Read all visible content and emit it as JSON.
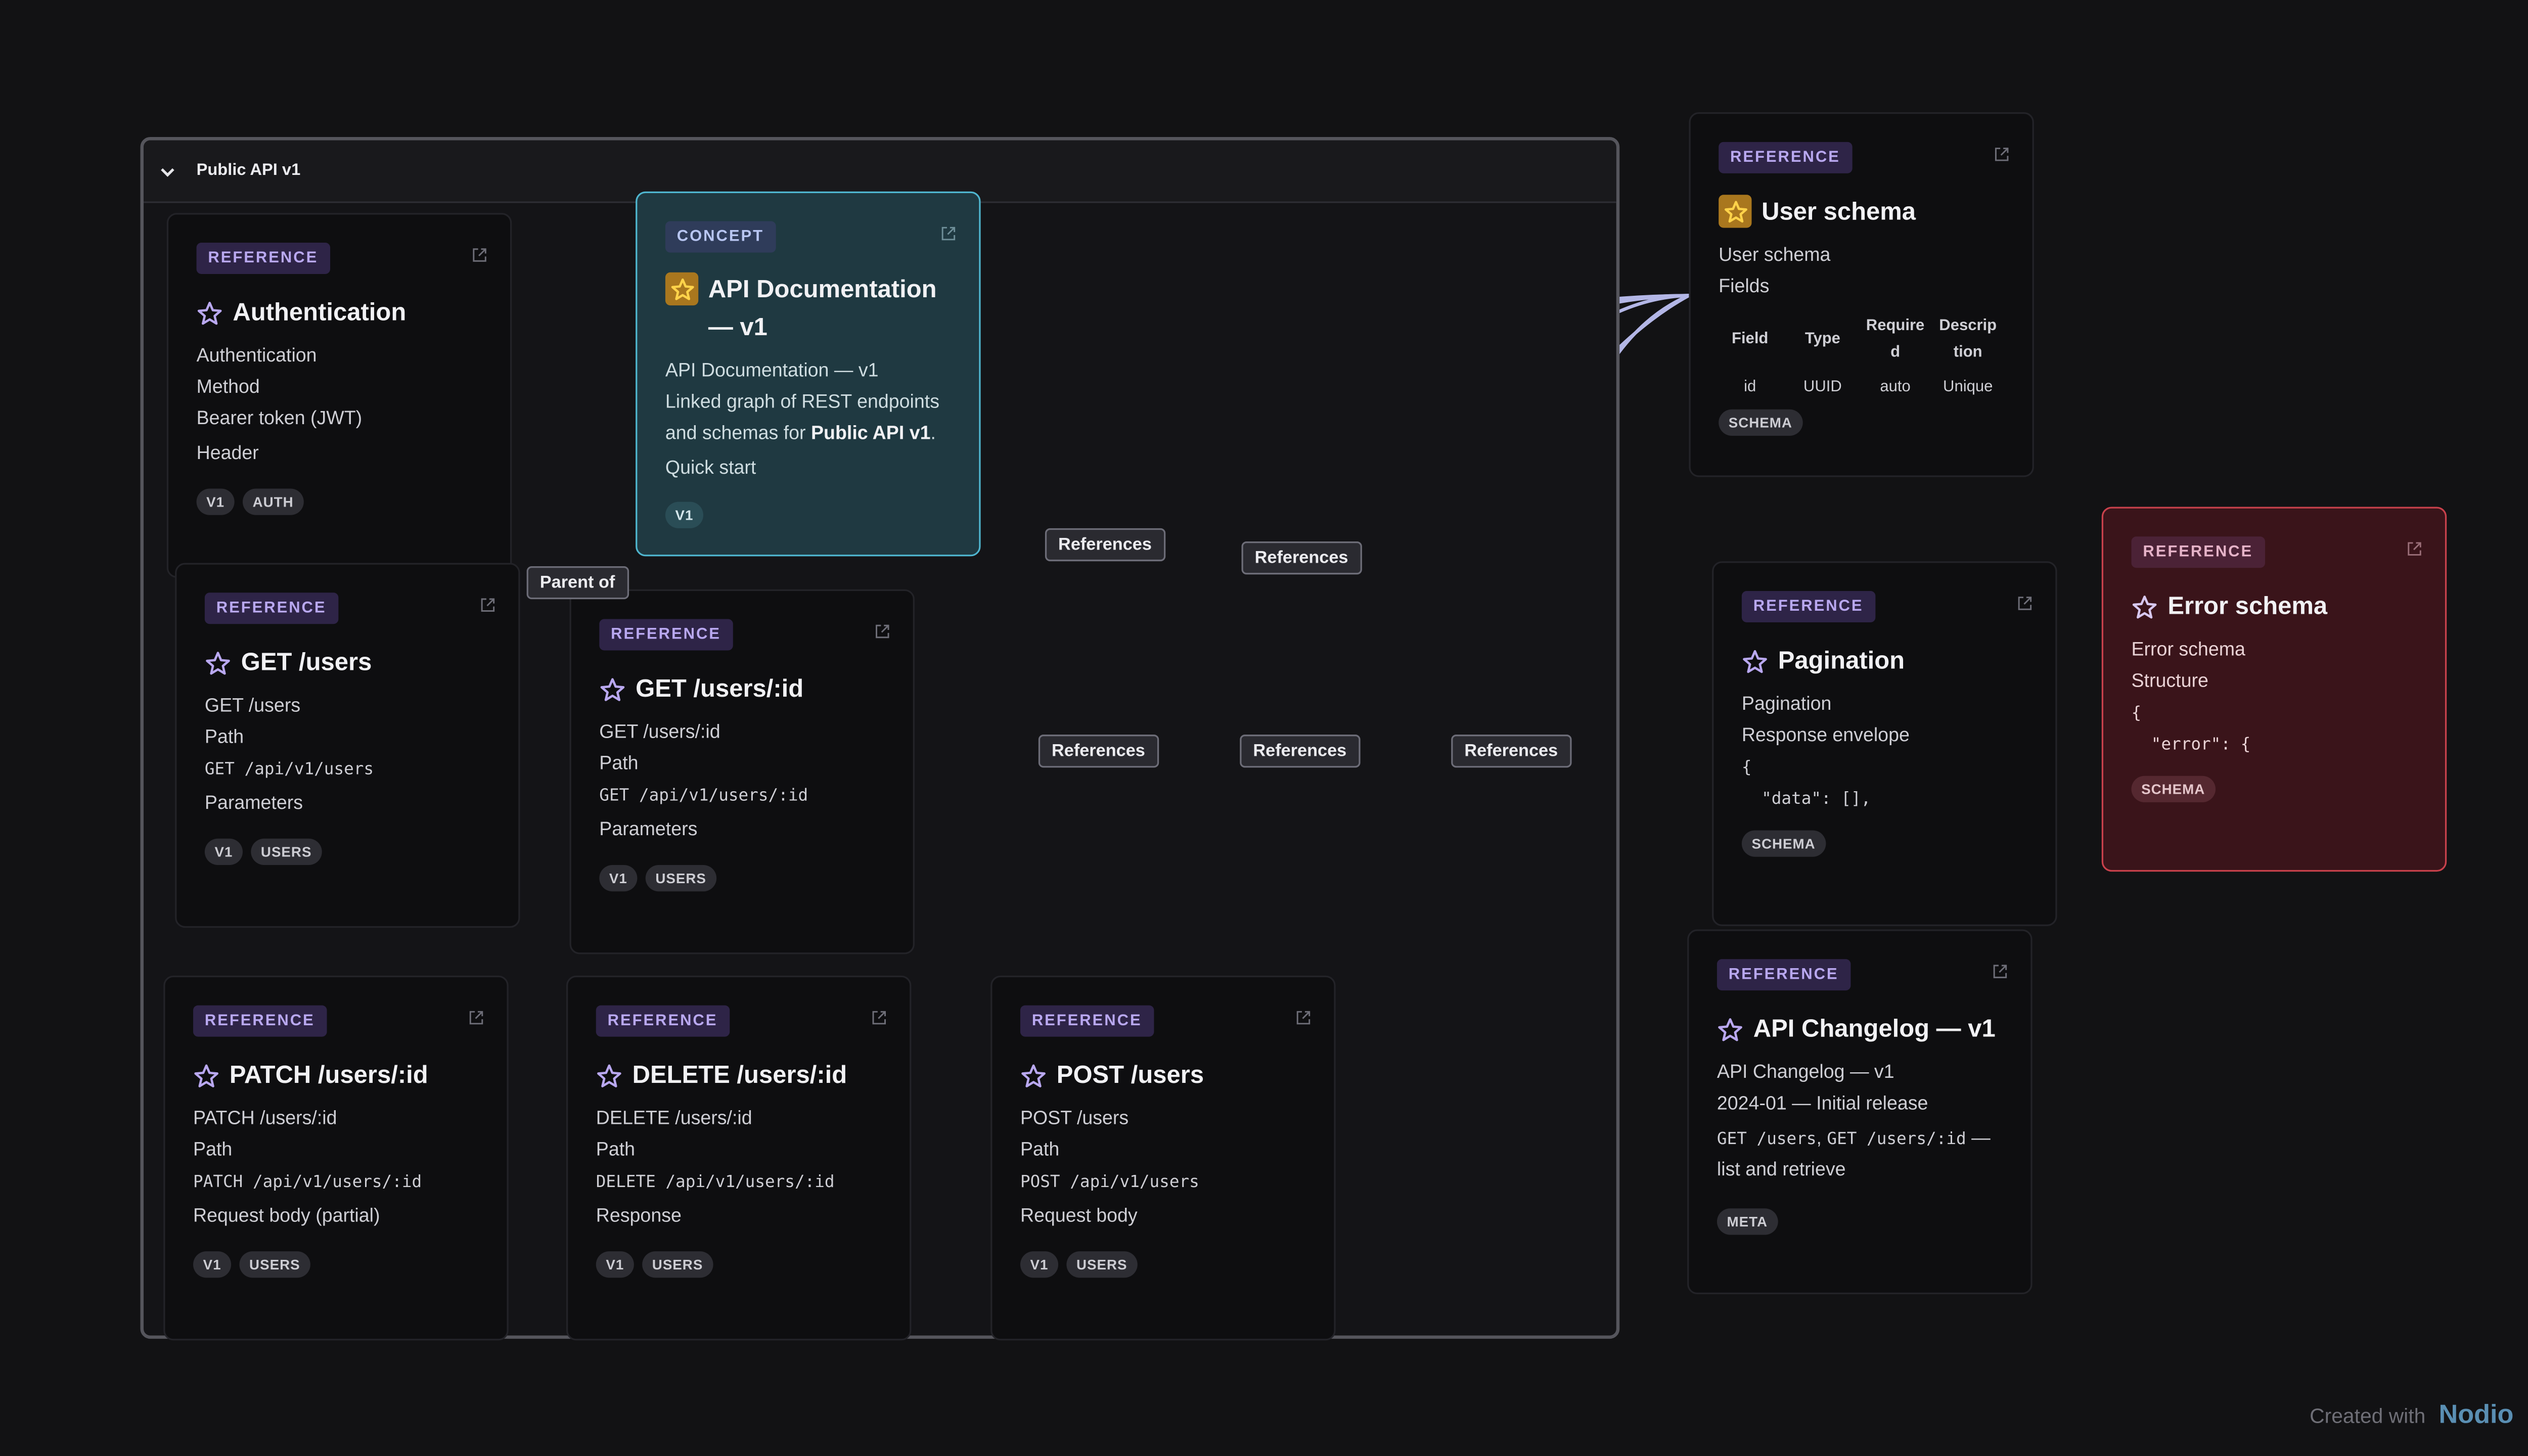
{
  "group": {
    "title": "Public API v1"
  },
  "edge_labels": {
    "parent_of": "Parent of",
    "references": "References"
  },
  "cards": {
    "authentication": {
      "pill": "REFERENCE",
      "title": "Authentication",
      "lines": [
        "Authentication",
        "Method",
        "Bearer token (JWT)",
        "Header"
      ],
      "tags": [
        "V1",
        "AUTH"
      ]
    },
    "api_doc": {
      "pill": "CONCEPT",
      "title": "API Documentation — v1",
      "line1": "API Documentation — v1",
      "desc_a": "Linked graph of REST endpoints and schemas for ",
      "desc_b": "Public API v1",
      "desc_c": ".",
      "line3": "Quick start",
      "tags": [
        "V1"
      ]
    },
    "get_users": {
      "pill": "REFERENCE",
      "title": "GET /users",
      "line1": "GET /users",
      "line2": "Path",
      "code": "GET /api/v1/users",
      "line4": "Parameters",
      "tags": [
        "V1",
        "USERS"
      ]
    },
    "get_user_id": {
      "pill": "REFERENCE",
      "title": "GET /users/:id",
      "line1": "GET /users/:id",
      "line2": "Path",
      "code": "GET /api/v1/users/:id",
      "line4": "Parameters",
      "tags": [
        "V1",
        "USERS"
      ]
    },
    "patch_user": {
      "pill": "REFERENCE",
      "title": "PATCH /users/:id",
      "line1": "PATCH /users/:id",
      "line2": "Path",
      "code": "PATCH /api/v1/users/:id",
      "line4": "Request body (partial)",
      "tags": [
        "V1",
        "USERS"
      ]
    },
    "delete_user": {
      "pill": "REFERENCE",
      "title": "DELETE /users/:id",
      "line1": "DELETE /users/:id",
      "line2": "Path",
      "code": "DELETE /api/v1/users/:id",
      "line4": "Response",
      "tags": [
        "V1",
        "USERS"
      ]
    },
    "post_users": {
      "pill": "REFERENCE",
      "title": "POST /users",
      "line1": "POST /users",
      "line2": "Path",
      "code": "POST /api/v1/users",
      "line4": "Request body",
      "tags": [
        "V1",
        "USERS"
      ]
    },
    "user_schema": {
      "pill": "REFERENCE",
      "title": "User schema",
      "line1": "User schema",
      "line2": "Fields",
      "table": {
        "headers": [
          "Field",
          "Type",
          "Require d",
          "Descrip tion"
        ],
        "row": [
          "id",
          "UUID",
          "auto",
          "Unique"
        ]
      },
      "tags": [
        "SCHEMA"
      ]
    },
    "pagination": {
      "pill": "REFERENCE",
      "title": "Pagination",
      "line1": "Pagination",
      "line2": "Response envelope",
      "code1": "{",
      "code2": "\"data\": [],",
      "tags": [
        "SCHEMA"
      ]
    },
    "error_schema": {
      "pill": "REFERENCE",
      "title": "Error schema",
      "line1": "Error schema",
      "line2": "Structure",
      "code1": "{",
      "code2": "\"error\": {",
      "tags": [
        "SCHEMA"
      ]
    },
    "changelog": {
      "pill": "REFERENCE",
      "title": "API Changelog — v1",
      "line1": "API Changelog — v1",
      "line2": "2024-01 — Initial release",
      "code_a": "GET /users",
      "sep": ", ",
      "code_b": "GET /users/:id",
      "rest": " — list and retrieve",
      "tags": [
        "META"
      ]
    }
  },
  "footer": {
    "created_with": "Created with",
    "brand": "Nodio"
  },
  "colors": {
    "edge": "#b3b6e6",
    "accent": "#b9a8f0",
    "concept_border": "#4fb6cf",
    "error_border": "#c9414c",
    "star_fill": "#a9771e"
  }
}
